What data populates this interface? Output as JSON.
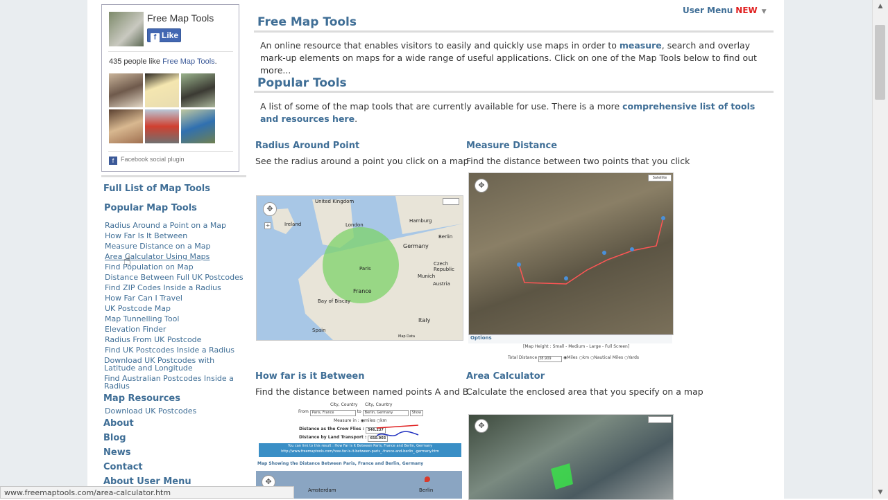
{
  "facebook": {
    "page_name": "Free Map Tools",
    "like_label": "Like",
    "like_icon": "f",
    "count_prefix": "435 people like ",
    "count_link": "Free Map Tools",
    "count_suffix": ".",
    "footer": "Facebook social plugin",
    "footer_icon": "f"
  },
  "sidebar": {
    "full_list": "Full List of Map Tools",
    "popular_heading": "Popular Map Tools",
    "popular_links": [
      "Radius Around a Point on a Map",
      "How Far Is It Between",
      "Measure Distance on a Map",
      "Area Calculator Using Maps",
      "Find Population on Map",
      "Distance Between Full UK Postcodes",
      "Find ZIP Codes Inside a Radius",
      "How Far Can I Travel",
      "UK Postcode Map",
      "Map Tunnelling Tool",
      "Elevation Finder",
      "Radius From UK Postcode",
      "Find UK Postcodes Inside a Radius",
      "Download UK Postcodes with Latitude and Longitude",
      "Find Australian Postcodes Inside a Radius"
    ],
    "resources_heading": "Map Resources",
    "resources_links": [
      "Download UK Postcodes"
    ],
    "about": "About",
    "blog": "Blog",
    "news": "News",
    "contact": "Contact",
    "about_user_menu": "About User Menu"
  },
  "header": {
    "user_menu": "User Menu",
    "new_badge": "NEW",
    "caret": "▼"
  },
  "main": {
    "title": "Free Map Tools",
    "intro_prefix": "An online resource that enables visitors to easily and quickly use maps in order to ",
    "intro_link": "measure",
    "intro_suffix": ", search and overlay mark-up elements on maps for a wide range of useful applications. Click on one of the Map Tools below to find out more...",
    "popular_title": "Popular Tools",
    "popular_prefix": "A list of some of the map tools that are currently available for use. There is a more ",
    "popular_link": "comprehensive list of tools and resources here",
    "popular_suffix": ".",
    "tools": [
      {
        "title": "Radius Around Point",
        "desc": "See the radius around a point you click on a map"
      },
      {
        "title": "Measure Distance",
        "desc": "Find the distance between two points that you click"
      },
      {
        "title": "How far is it Between",
        "desc": "Find the distance between named points A and B"
      },
      {
        "title": "Area Calculator",
        "desc": "Calculate the enclosed area that you specify on a map"
      }
    ]
  },
  "map_radius": {
    "labels": [
      "United Kingdom",
      "Ireland",
      "London",
      "Paris",
      "France",
      "Germany",
      "Czech Republic",
      "Austria",
      "Italy",
      "Spain",
      "Hamburg",
      "Berlin",
      "Munich",
      "Bay of Biscay"
    ],
    "zoom_plus": "+",
    "footer": "Map Data"
  },
  "map_measure": {
    "options": "Options",
    "size_line": "[Map Height : Small - Medium - Large - Full Screen]",
    "total_label": "Total Distance",
    "total_value": "38.909",
    "units": [
      "Miles",
      "km",
      "Nautical Miles",
      "Yards"
    ],
    "map_type": "Satellite"
  },
  "howfar_form": {
    "city_country_1": "City, Country",
    "city_country_2": "City, Country",
    "from_label": "From",
    "from_value": "Paris, France",
    "to_label": "to",
    "to_value": "Berlin, Germany",
    "show_button": "Show",
    "measure_in": "Measure in :",
    "measure_units": [
      "miles",
      "km"
    ],
    "crow_label": "Distance as the Crow Flies :",
    "crow_value": "546.237",
    "transport_label": "Distance by Land Transport :",
    "transport_value": "650.903",
    "banner_line1": "You can link to this result : How Far Is It Between Paris, France and Berlin, Germany",
    "banner_line2": "http://www.freemaptools.com/how-far-is-it-between-paris_-france-and-berlin_-germany.htm",
    "caption": "Map Showing the Distance Between Paris, France and Berlin, Germany",
    "map_labels": [
      "Amsterdam",
      "Berlin"
    ]
  },
  "status_bar": {
    "url": "www.freemaptools.com/area-calculator.htm"
  }
}
